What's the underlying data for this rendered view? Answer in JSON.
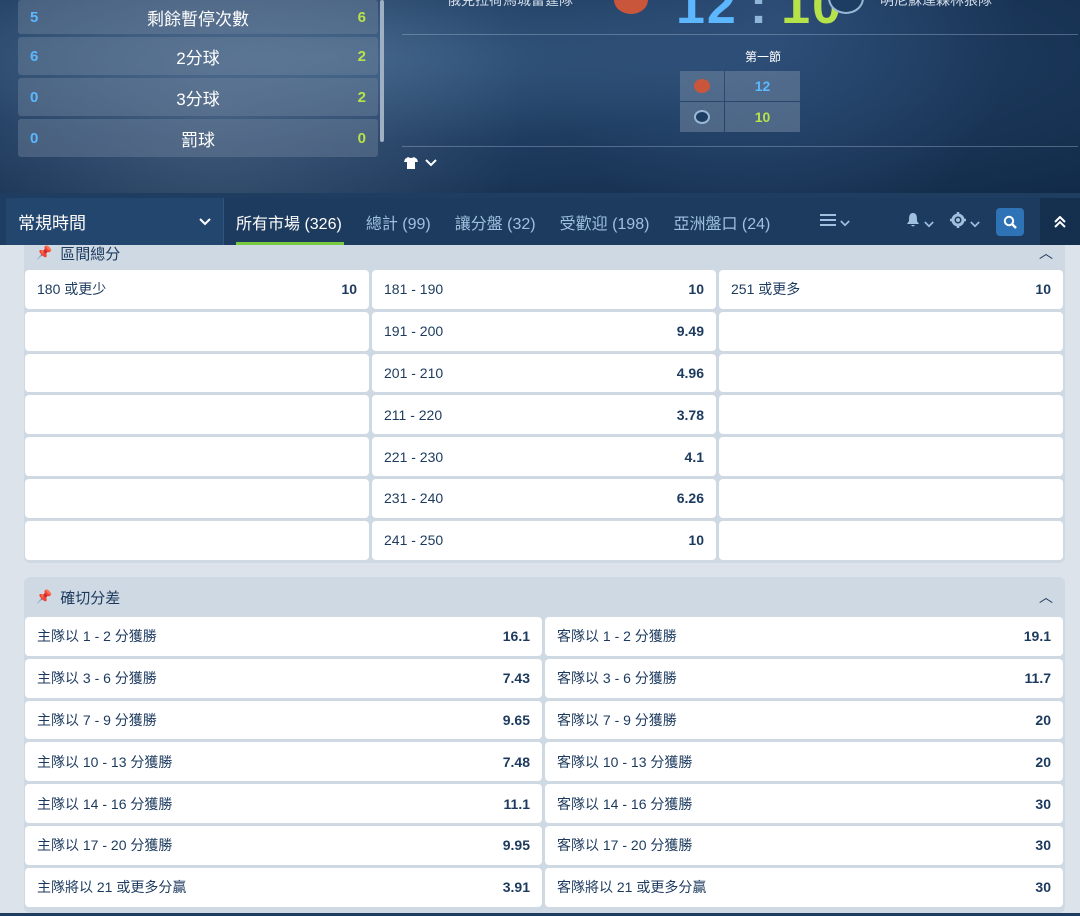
{
  "scoreboard": {
    "stats": [
      {
        "home": "5",
        "label": "剩餘暫停次數",
        "away": "6"
      },
      {
        "home": "6",
        "label": "2分球",
        "away": "2"
      },
      {
        "home": "0",
        "label": "3分球",
        "away": "2"
      },
      {
        "home": "0",
        "label": "罰球",
        "away": "0"
      }
    ],
    "home_team": "俄克拉荷馬城雷霆隊",
    "away_team": "明尼蘇達森林狼隊",
    "home_score": "12",
    "separator": ":",
    "away_score": "10",
    "period_label": "第一節",
    "period_home": "12",
    "period_away": "10",
    "jersey_icon": "shirt-icon",
    "colors": {
      "home": "#5db7ff",
      "away": "#b7e34a"
    }
  },
  "nav": {
    "period_select": "常規時間",
    "tabs": [
      {
        "label": "所有市場 (326)",
        "active": true
      },
      {
        "label": "總計 (99)"
      },
      {
        "label": "讓分盤 (32)"
      },
      {
        "label": "受歡迎 (198)"
      },
      {
        "label": "亞洲盤口 (24)"
      }
    ]
  },
  "market_range": {
    "title": "區間總分",
    "col1": [
      {
        "label": "180 或更少",
        "odd": "10"
      }
    ],
    "col2": [
      {
        "label": "181 - 190",
        "odd": "10"
      },
      {
        "label": "191 - 200",
        "odd": "9.49"
      },
      {
        "label": "201 - 210",
        "odd": "4.96"
      },
      {
        "label": "211 - 220",
        "odd": "3.78"
      },
      {
        "label": "221 - 230",
        "odd": "4.1"
      },
      {
        "label": "231 - 240",
        "odd": "6.26"
      },
      {
        "label": "241 - 250",
        "odd": "10"
      }
    ],
    "col3": [
      {
        "label": "251 或更多",
        "odd": "10"
      }
    ]
  },
  "market_margin": {
    "title": "確切分差",
    "rows": [
      {
        "home_label": "主隊以 1 - 2 分獲勝",
        "home_odd": "16.1",
        "away_label": "客隊以 1 - 2 分獲勝",
        "away_odd": "19.1"
      },
      {
        "home_label": "主隊以 3 - 6 分獲勝",
        "home_odd": "7.43",
        "away_label": "客隊以 3 - 6 分獲勝",
        "away_odd": "11.7"
      },
      {
        "home_label": "主隊以 7 - 9 分獲勝",
        "home_odd": "9.65",
        "away_label": "客隊以 7 - 9 分獲勝",
        "away_odd": "20"
      },
      {
        "home_label": "主隊以 10 - 13 分獲勝",
        "home_odd": "7.48",
        "away_label": "客隊以 10 - 13 分獲勝",
        "away_odd": "20"
      },
      {
        "home_label": "主隊以 14 - 16 分獲勝",
        "home_odd": "11.1",
        "away_label": "客隊以 14 - 16 分獲勝",
        "away_odd": "30"
      },
      {
        "home_label": "主隊以 17 - 20 分獲勝",
        "home_odd": "9.95",
        "away_label": "客隊以 17 - 20 分獲勝",
        "away_odd": "30"
      },
      {
        "home_label": "主隊將以 21 或更多分贏",
        "home_odd": "3.91",
        "away_label": "客隊將以 21 或更多分贏",
        "away_odd": "30"
      }
    ]
  }
}
